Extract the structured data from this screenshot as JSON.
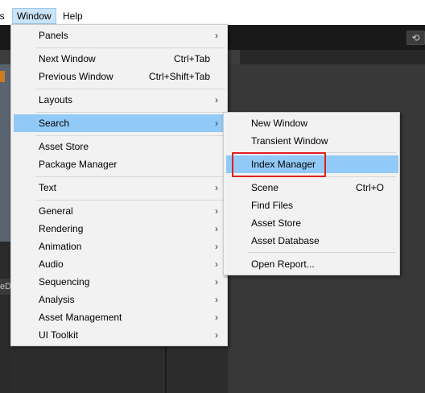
{
  "menubar": {
    "cut_item": "ls",
    "window_label": "Window",
    "help_label": "Help"
  },
  "toolbar": {
    "history_icon": "history-icon"
  },
  "window_menu": {
    "items": [
      {
        "label": "Panels",
        "submenu": true
      },
      {
        "label": "Next Window",
        "shortcut": "Ctrl+Tab"
      },
      {
        "label": "Previous Window",
        "shortcut": "Ctrl+Shift+Tab"
      },
      {
        "label": "Layouts",
        "submenu": true
      },
      {
        "label": "Search",
        "submenu": true,
        "highlighted": true
      },
      {
        "label": "Asset Store"
      },
      {
        "label": "Package Manager"
      },
      {
        "label": "Text",
        "submenu": true
      },
      {
        "label": "General",
        "submenu": true
      },
      {
        "label": "Rendering",
        "submenu": true
      },
      {
        "label": "Animation",
        "submenu": true
      },
      {
        "label": "Audio",
        "submenu": true
      },
      {
        "label": "Sequencing",
        "submenu": true
      },
      {
        "label": "Analysis",
        "submenu": true
      },
      {
        "label": "Asset Management",
        "submenu": true
      },
      {
        "label": "UI Toolkit",
        "submenu": true
      }
    ]
  },
  "search_submenu": {
    "items": [
      {
        "label": "New Window"
      },
      {
        "label": "Transient Window"
      },
      {
        "label": "Index Manager",
        "highlighted": true
      },
      {
        "label": "Scene",
        "shortcut": "Ctrl+O"
      },
      {
        "label": "Find Files"
      },
      {
        "label": "Asset Store"
      },
      {
        "label": "Asset Database"
      },
      {
        "label": "Open Report..."
      }
    ]
  },
  "side_chip_text": "eD",
  "arrow_glyph": "›",
  "colors": {
    "highlight": "#91c9f7",
    "annotation_box": "#e02020",
    "menu_bg": "#f2f2f2"
  }
}
